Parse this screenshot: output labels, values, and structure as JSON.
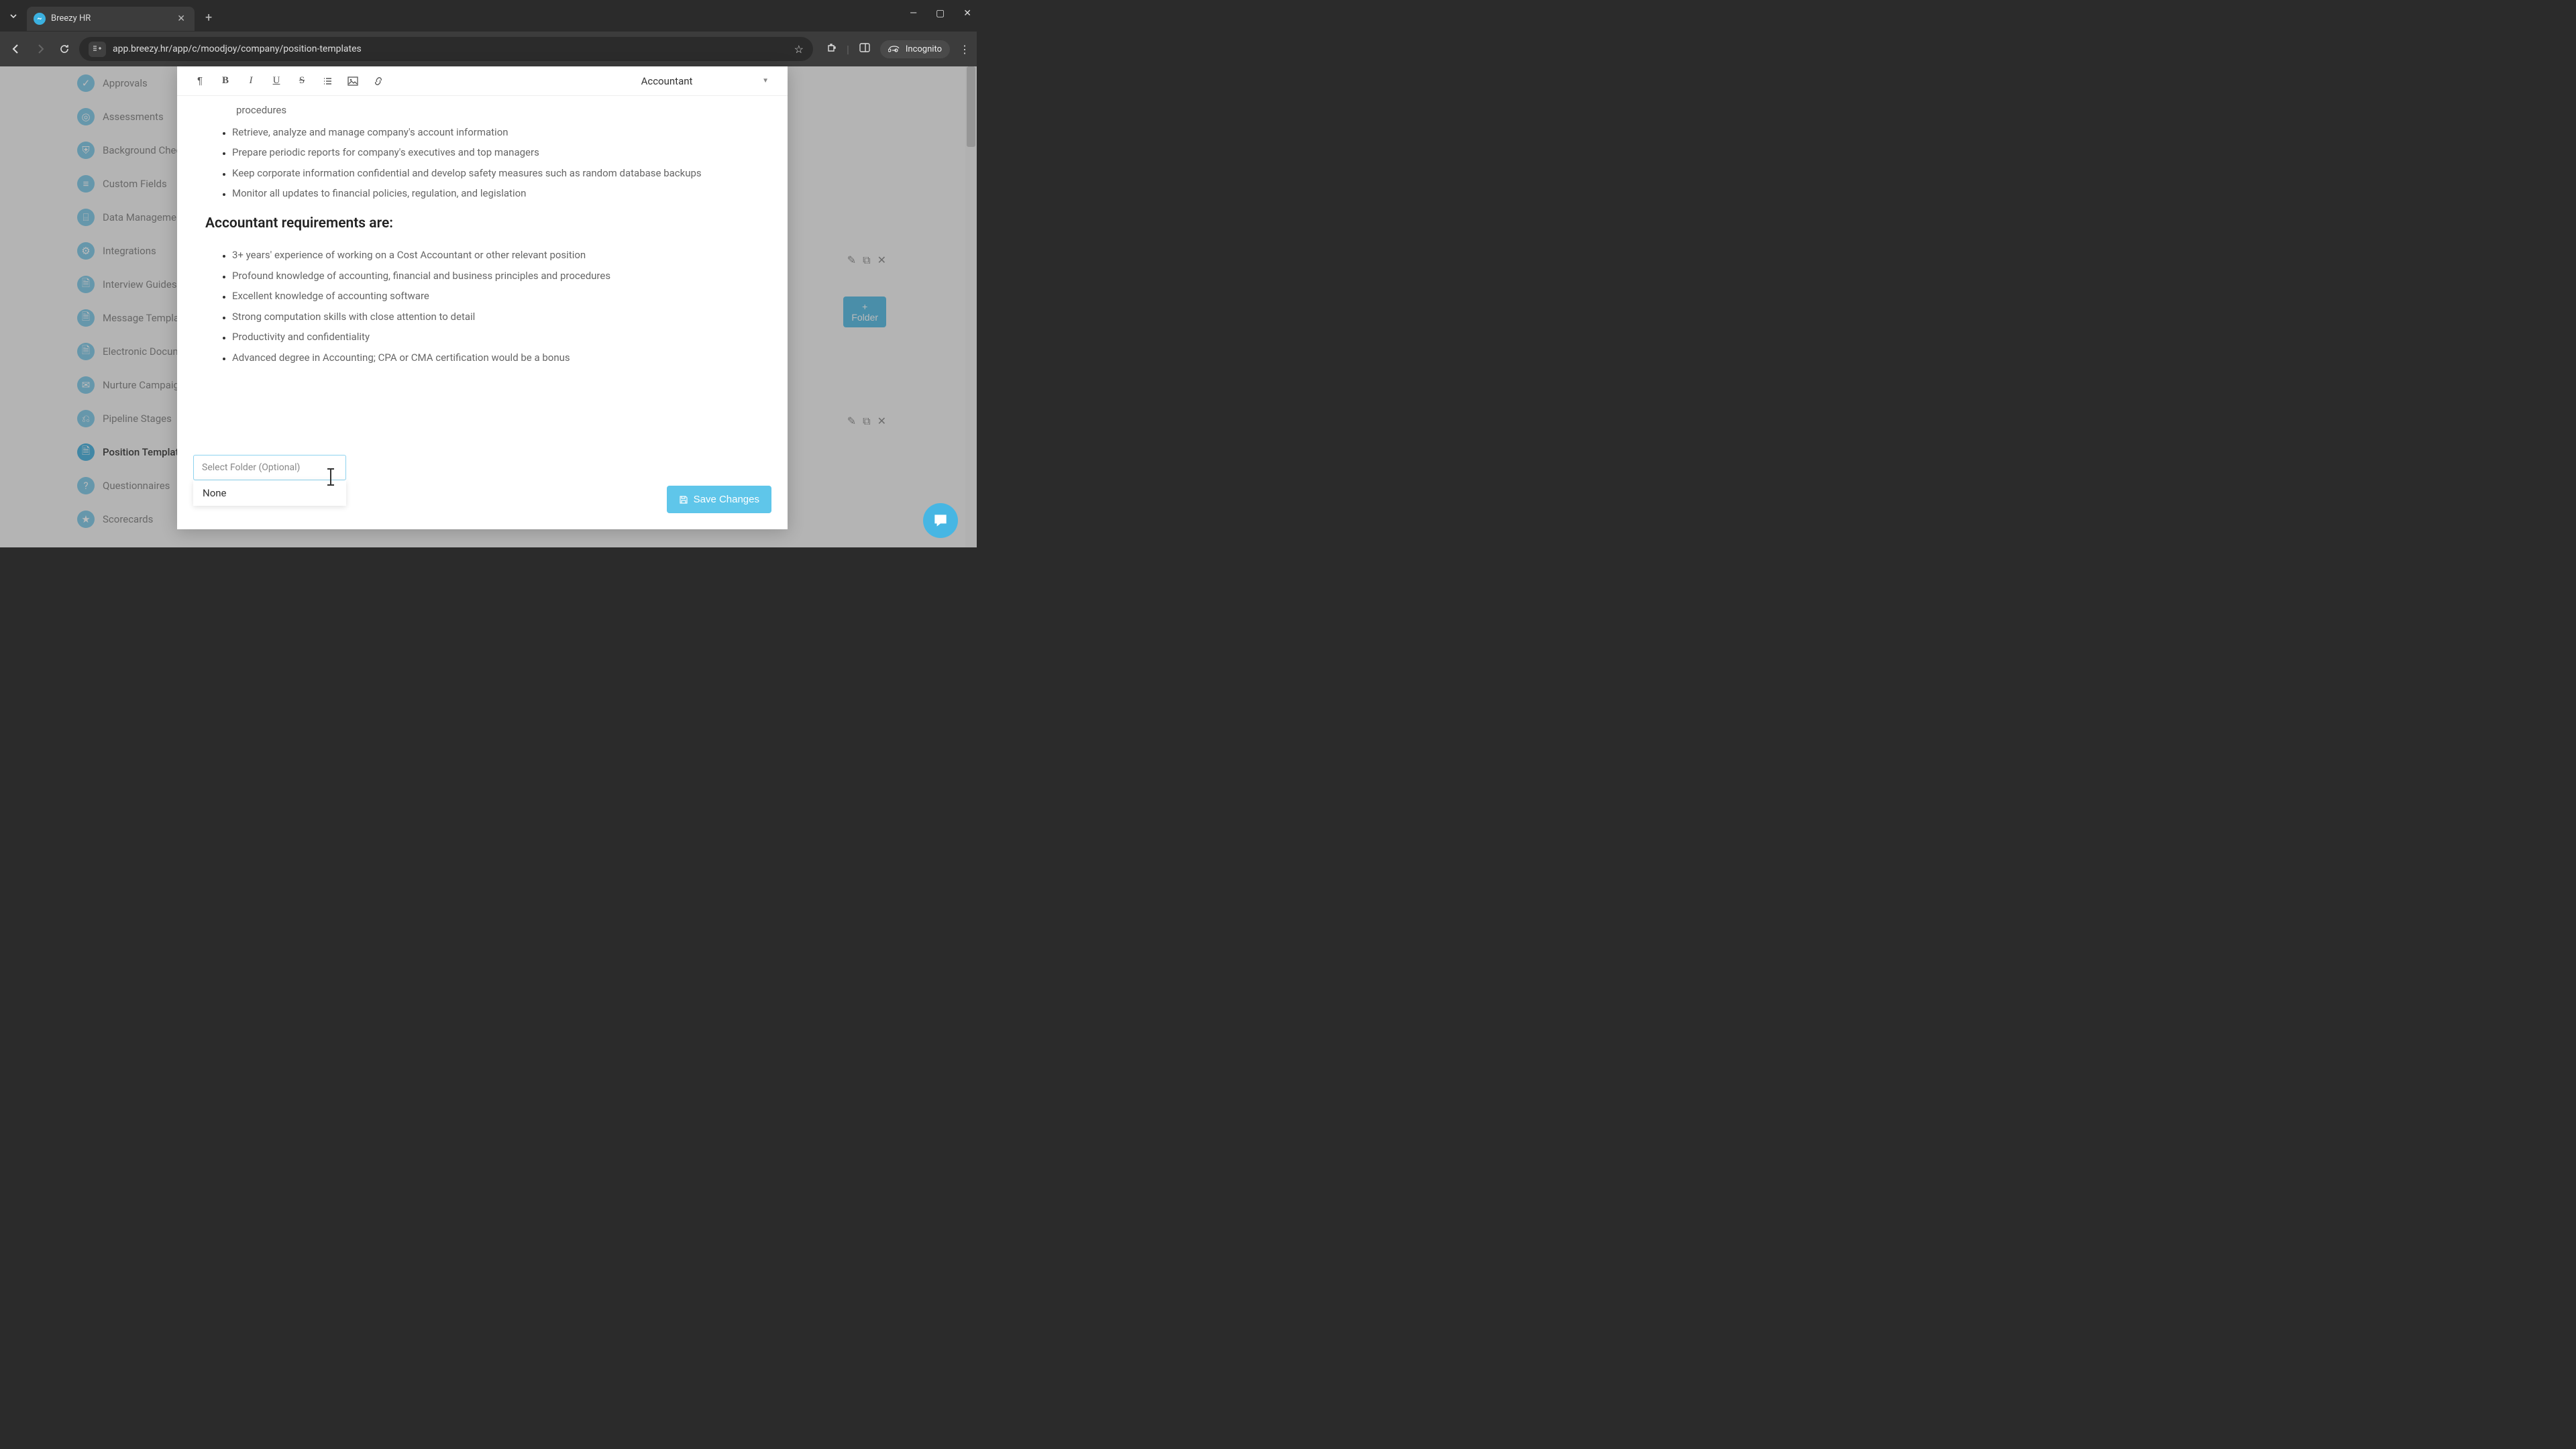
{
  "browser": {
    "tab_title": "Breezy HR",
    "url": "app.breezy.hr/app/c/moodjoy/company/position-templates",
    "incognito_label": "Incognito"
  },
  "sidebar": {
    "items": [
      {
        "label": "Approvals"
      },
      {
        "label": "Assessments"
      },
      {
        "label": "Background Checks"
      },
      {
        "label": "Custom Fields"
      },
      {
        "label": "Data Management"
      },
      {
        "label": "Integrations"
      },
      {
        "label": "Interview Guides"
      },
      {
        "label": "Message Templates"
      },
      {
        "label": "Electronic Documents"
      },
      {
        "label": "Nurture Campaigns"
      },
      {
        "label": "Pipeline Stages"
      },
      {
        "label": "Position Templates"
      },
      {
        "label": "Questionnaires"
      },
      {
        "label": "Scorecards"
      }
    ],
    "active_index": 11
  },
  "right_panel": {
    "folder_button": "+ Folder"
  },
  "modal": {
    "template_selected": "Accountant",
    "trail_line": "procedures",
    "responsibilities": [
      "Retrieve, analyze and manage company's account information",
      "Prepare periodic reports for company's executives and top managers",
      "Keep corporate information confidential and develop safety measures such as random database backups",
      "Monitor all updates to financial policies, regulation, and legislation"
    ],
    "requirements_heading": "Accountant requirements are:",
    "requirements": [
      "3+ years' experience of working on a Cost Accountant or other relevant position",
      "Profound knowledge of accounting, financial and business principles and procedures",
      "Excellent knowledge of accounting software",
      "Strong computation skills with close attention to detail",
      "Productivity and confidentiality",
      "Advanced degree in Accounting; CPA or CMA certification would be a bonus"
    ],
    "folder_placeholder": "Select Folder (Optional)",
    "folder_option_none": "None",
    "save_label": "Save Changes"
  }
}
